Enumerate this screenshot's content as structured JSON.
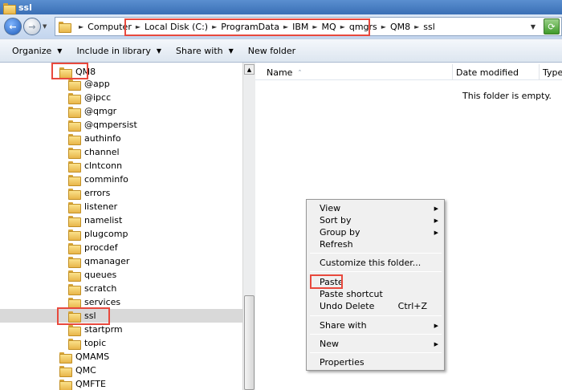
{
  "window": {
    "title": "ssl"
  },
  "address": {
    "computer": "Computer",
    "crumbs": [
      "Local Disk (C:)",
      "ProgramData",
      "IBM",
      "MQ",
      "qmgrs",
      "QM8",
      "ssl"
    ]
  },
  "toolbar": {
    "organize": "Organize",
    "include_in_library": "Include in library",
    "share_with": "Share with",
    "new_folder": "New folder"
  },
  "tree": {
    "items": [
      "QM8",
      "@app",
      "@ipcc",
      "@qmgr",
      "@qmpersist",
      "authinfo",
      "channel",
      "clntconn",
      "comminfo",
      "errors",
      "listener",
      "namelist",
      "plugcomp",
      "procdef",
      "qmanager",
      "queues",
      "scratch",
      "services",
      "ssl",
      "startprm",
      "topic",
      "QMAMS",
      "QMC",
      "QMFTE"
    ],
    "selected": "ssl"
  },
  "columns": {
    "name": "Name",
    "date_modified": "Date modified",
    "type": "Type"
  },
  "empty_message": "This folder is empty.",
  "context_menu": {
    "view": "View",
    "sort_by": "Sort by",
    "group_by": "Group by",
    "refresh": "Refresh",
    "customize": "Customize this folder...",
    "paste": "Paste",
    "paste_shortcut": "Paste shortcut",
    "undo_delete": "Undo Delete",
    "undo_shortcut": "Ctrl+Z",
    "share_with": "Share with",
    "new": "New",
    "properties": "Properties"
  },
  "colors": {
    "highlight": "#e8493d",
    "selection": "#d9d9d9"
  }
}
